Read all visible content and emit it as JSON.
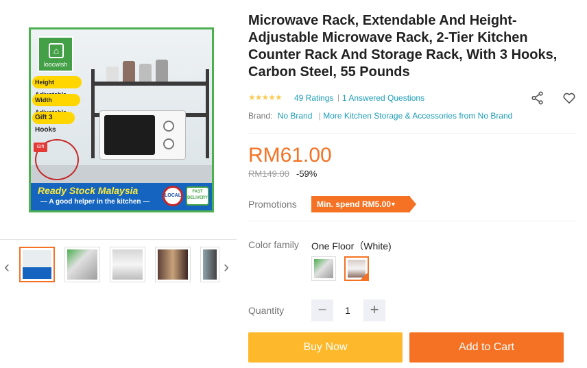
{
  "product": {
    "title": "Microwave Rack, Extendable And Height-Adjustable Microwave Rack, 2-Tier Kitchen Counter Rack And Storage Rack, With 3 Hooks, Carbon Steel, 55 Pounds",
    "rating_stars": "★★★★★",
    "rating_count_text": "49 Ratings",
    "rating_separator": "|",
    "answered_text": "1 Answered Questions",
    "brand_label": "Brand:",
    "brand_value": "No Brand",
    "brand_more": "More Kitchen Storage & Accessories from No Brand",
    "price": "RM61.00",
    "original_price": "RM149.00",
    "discount": "-59%"
  },
  "image": {
    "logo_text": "loocwish",
    "pill_1": "Height Adjustable",
    "pill_2": "Width Adjustable",
    "pill_3": "Gift 3 Hooks",
    "gift_tag": "Gift",
    "banner_title": "Ready Stock Malaysia",
    "banner_subtitle": "— A good helper in the kitchen —",
    "badge_local": "LOCAL",
    "badge_delivery": "FAST DELIVERY"
  },
  "gallery": {
    "prev_arrow": "‹",
    "next_arrow": "›"
  },
  "promotions": {
    "label": "Promotions",
    "tag": "Min. spend RM5.00",
    "caret": "▼"
  },
  "variant": {
    "label": "Color family",
    "selected": "One Floor（White)"
  },
  "quantity": {
    "label": "Quantity",
    "minus": "−",
    "value": "1",
    "plus": "+"
  },
  "actions": {
    "buy_now": "Buy Now",
    "add_to_cart": "Add to Cart"
  },
  "icons": {
    "share": "share-icon",
    "wishlist": "heart-icon"
  },
  "colors": {
    "accent": "#f57224",
    "buy_now": "#fdb92b",
    "link": "#1a9cb7",
    "star": "#faca51"
  }
}
